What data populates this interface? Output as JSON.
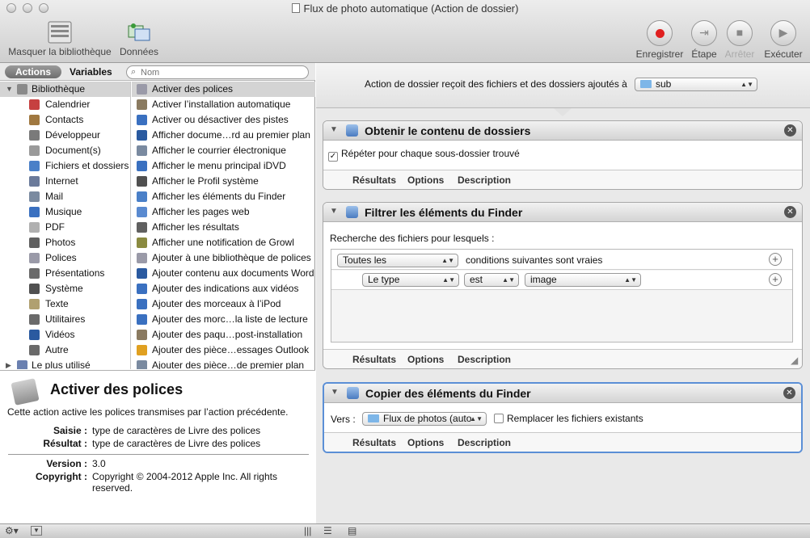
{
  "window": {
    "title": "Flux de photo automatique (Action de dossier)"
  },
  "toolbar": {
    "hide_library": "Masquer la bibliothèque",
    "media": "Données",
    "record": "Enregistrer",
    "step": "Étape",
    "stop": "Arrêter",
    "run": "Exécuter"
  },
  "library": {
    "tab_actions": "Actions",
    "tab_variables": "Variables",
    "search_placeholder": "Nom",
    "categories": [
      {
        "label": "Bibliothèque",
        "icon": "library-icon",
        "color": "#8a8a8a"
      },
      {
        "label": "Calendrier",
        "icon": "calendar-icon",
        "color": "#c64040"
      },
      {
        "label": "Contacts",
        "icon": "contacts-icon",
        "color": "#a07840"
      },
      {
        "label": "Développeur",
        "icon": "developer-icon",
        "color": "#7a7a7a"
      },
      {
        "label": "Document(s)",
        "icon": "document-icon",
        "color": "#9a9a9a"
      },
      {
        "label": "Fichiers et dossiers",
        "icon": "finder-icon",
        "color": "#4a80c8"
      },
      {
        "label": "Internet",
        "icon": "globe-icon",
        "color": "#6a7a9a"
      },
      {
        "label": "Mail",
        "icon": "mail-icon",
        "color": "#7a8aa0"
      },
      {
        "label": "Musique",
        "icon": "music-icon",
        "color": "#3a70c0"
      },
      {
        "label": "PDF",
        "icon": "pdf-icon",
        "color": "#b0b0b0"
      },
      {
        "label": "Photos",
        "icon": "photos-icon",
        "color": "#606060"
      },
      {
        "label": "Polices",
        "icon": "fonts-icon",
        "color": "#9a9aa8"
      },
      {
        "label": "Présentations",
        "icon": "presentations-icon",
        "color": "#6a6a6a"
      },
      {
        "label": "Système",
        "icon": "system-icon",
        "color": "#505050"
      },
      {
        "label": "Texte",
        "icon": "text-icon",
        "color": "#b0a070"
      },
      {
        "label": "Utilitaires",
        "icon": "utilities-icon",
        "color": "#6a6a6a"
      },
      {
        "label": "Vidéos",
        "icon": "video-icon",
        "color": "#2a5aa0"
      },
      {
        "label": "Autre",
        "icon": "other-icon",
        "color": "#6a6a6a"
      },
      {
        "label": "Le plus utilisé",
        "icon": "most-used-icon",
        "color": "#6a80b0"
      }
    ],
    "actions": [
      {
        "label": "Activer des polices",
        "icon": "fonts-icon",
        "color": "#9a9aa8"
      },
      {
        "label": "Activer l’installation automatique",
        "icon": "installer-icon",
        "color": "#8a7a60"
      },
      {
        "label": "Activer ou désactiver des pistes",
        "icon": "quicktime-icon",
        "color": "#3a70c0"
      },
      {
        "label": "Afficher docume…rd au premier plan",
        "icon": "word-icon",
        "color": "#2a5aa0"
      },
      {
        "label": "Afficher le courrier électronique",
        "icon": "mail-icon",
        "color": "#7a8aa0"
      },
      {
        "label": "Afficher le menu principal iDVD",
        "icon": "idvd-icon",
        "color": "#3a70c0"
      },
      {
        "label": "Afficher le Profil système",
        "icon": "system-profile-icon",
        "color": "#505050"
      },
      {
        "label": "Afficher les éléments du Finder",
        "icon": "finder-icon",
        "color": "#4a80c8"
      },
      {
        "label": "Afficher les pages web",
        "icon": "safari-icon",
        "color": "#5a8ad0"
      },
      {
        "label": "Afficher les résultats",
        "icon": "view-results-icon",
        "color": "#606060"
      },
      {
        "label": "Afficher une notification de Growl",
        "icon": "growl-icon",
        "color": "#8a8a40"
      },
      {
        "label": "Ajouter à une bibliothèque de polices",
        "icon": "fonts-icon",
        "color": "#9a9aa8"
      },
      {
        "label": "Ajouter contenu aux documents Word",
        "icon": "word-icon",
        "color": "#2a5aa0"
      },
      {
        "label": "Ajouter des indications aux vidéos",
        "icon": "quicktime-icon",
        "color": "#3a70c0"
      },
      {
        "label": "Ajouter des morceaux à l’iPod",
        "icon": "itunes-icon",
        "color": "#3a70c0"
      },
      {
        "label": "Ajouter des morc…la liste de lecture",
        "icon": "itunes-icon",
        "color": "#3a70c0"
      },
      {
        "label": "Ajouter des paqu…post-installation",
        "icon": "installer-icon",
        "color": "#8a7a60"
      },
      {
        "label": "Ajouter des pièce…essages Outlook",
        "icon": "outlook-icon",
        "color": "#e0a020"
      },
      {
        "label": "Ajouter des pièce…de premier plan",
        "icon": "mail-icon",
        "color": "#7a8aa0"
      }
    ]
  },
  "description": {
    "title": "Activer des polices",
    "text": "Cette action active les polices transmises par l’action précédente.",
    "input_label": "Saisie :",
    "input_value": "type de caractères de Livre des polices",
    "result_label": "Résultat :",
    "result_value": "type de caractères de Livre des polices",
    "version_label": "Version :",
    "version_value": "3.0",
    "copyright_label": "Copyright :",
    "copyright_value": "Copyright © 2004-2012 Apple Inc.  All rights reserved."
  },
  "workflow": {
    "header_text": "Action de dossier reçoit des fichiers et des dossiers ajoutés à",
    "folder_value": "sub",
    "actions": [
      {
        "title": "Obtenir le contenu de dossiers",
        "checkbox_label": "Répéter pour chaque sous-dossier trouvé",
        "checked": true,
        "footer": [
          "Résultats",
          "Options",
          "Description"
        ]
      },
      {
        "title": "Filtrer les éléments du Finder",
        "search_label": "Recherche des fichiers pour lesquels :",
        "match_value": "Toutes les",
        "match_suffix": "conditions suivantes sont vraies",
        "criteria_field": "Le type",
        "criteria_op": "est",
        "criteria_value": "image",
        "footer": [
          "Résultats",
          "Options",
          "Description"
        ]
      },
      {
        "title": "Copier des éléments du Finder",
        "to_label": "Vers :",
        "to_value": "Flux de photos (auto",
        "replace_label": "Remplacer les fichiers existants",
        "checked": false,
        "footer": [
          "Résultats",
          "Options",
          "Description"
        ]
      }
    ]
  }
}
